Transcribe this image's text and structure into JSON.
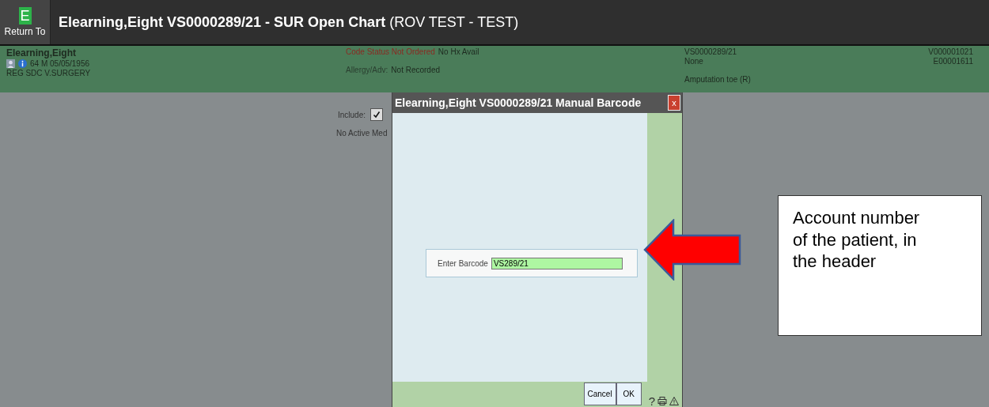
{
  "top_bar": {
    "logo_letter": "E",
    "return_label": "Return To",
    "title": "**Elearning,Eight VS0000289/21 - SUR Open Chart** (ROV TEST - TEST)"
  },
  "patient_header": {
    "name": "Elearning,Eight",
    "demographics": "64  M  05/05/1956",
    "location": "REG SDC  V.SURGERY",
    "code_status": "Code Status Not Ordered",
    "history": "No Hx Avail",
    "allergy_label": "Allergy/Adv:",
    "allergy_value": "Not Recorded",
    "account": "VS0000289/21",
    "field_2": "None",
    "procedure": "Amputation toe (R)",
    "visit_id": "V000001021",
    "encounter_id": "E00001611"
  },
  "background_panel": {
    "include_label": "Include:",
    "include_checked": true,
    "note": "No Active Med"
  },
  "dialog": {
    "title": "Elearning,Eight VS0000289/21 Manual Barcode",
    "close": "x",
    "field_label": "Enter Barcode",
    "field_value": "VS289/21",
    "buttons": [
      "Cancel",
      "OK"
    ],
    "help": "?"
  },
  "callout": {
    "text": "Account number of the patient, in the header"
  }
}
